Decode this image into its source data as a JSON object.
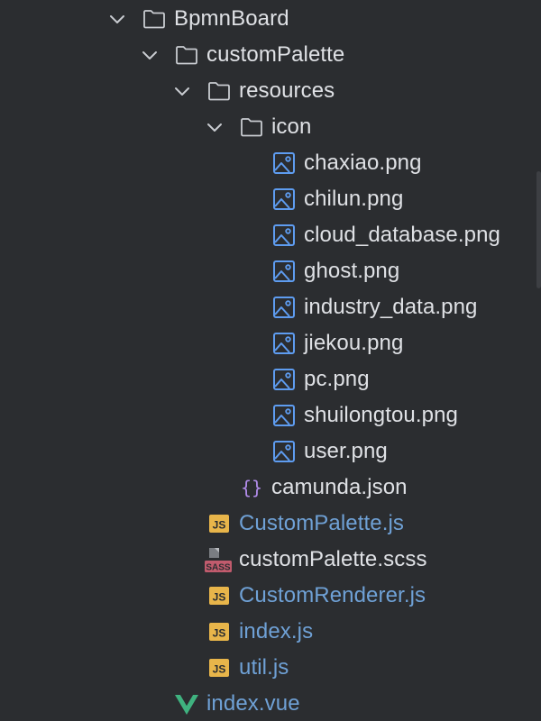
{
  "tree": {
    "items": [
      {
        "label": "BpmnBoard",
        "kind": "folder",
        "expanded": true,
        "depth": 0
      },
      {
        "label": "customPalette",
        "kind": "folder",
        "expanded": true,
        "depth": 1
      },
      {
        "label": "resources",
        "kind": "folder",
        "expanded": true,
        "depth": 2
      },
      {
        "label": "icon",
        "kind": "folder",
        "expanded": true,
        "depth": 3
      },
      {
        "label": "chaxiao.png",
        "kind": "image",
        "depth": 4
      },
      {
        "label": "chilun.png",
        "kind": "image",
        "depth": 4
      },
      {
        "label": "cloud_database.png",
        "kind": "image",
        "depth": 4
      },
      {
        "label": "ghost.png",
        "kind": "image",
        "depth": 4
      },
      {
        "label": "industry_data.png",
        "kind": "image",
        "depth": 4
      },
      {
        "label": "jiekou.png",
        "kind": "image",
        "depth": 4
      },
      {
        "label": "pc.png",
        "kind": "image",
        "depth": 4
      },
      {
        "label": "shuilongtou.png",
        "kind": "image",
        "depth": 4
      },
      {
        "label": "user.png",
        "kind": "image",
        "depth": 4
      },
      {
        "label": "camunda.json",
        "kind": "json",
        "depth": 3
      },
      {
        "label": "CustomPalette.js",
        "kind": "js",
        "depth": 2,
        "modified": true
      },
      {
        "label": "customPalette.scss",
        "kind": "sass",
        "depth": 2
      },
      {
        "label": "CustomRenderer.js",
        "kind": "js",
        "depth": 2,
        "modified": true
      },
      {
        "label": "index.js",
        "kind": "js",
        "depth": 2,
        "modified": true
      },
      {
        "label": "util.js",
        "kind": "js",
        "depth": 2,
        "modified": true
      },
      {
        "label": "index.vue",
        "kind": "vue",
        "depth": 1,
        "modified": true
      }
    ]
  },
  "badges": {
    "js": "JS",
    "sass": "SASS",
    "json": "{}"
  },
  "colors": {
    "background": "#2b2d30",
    "text": "#dfe1e5",
    "modified_text": "#6fa1d6",
    "folder_stroke": "#c9ccd1",
    "image_icon": "#5e9cf0",
    "js_badge": "#e8b54a",
    "sass_badge": "#c15b6d",
    "json_braces": "#b08be8",
    "vue": "#3fb27f",
    "chevron": "#c9ccd1"
  }
}
